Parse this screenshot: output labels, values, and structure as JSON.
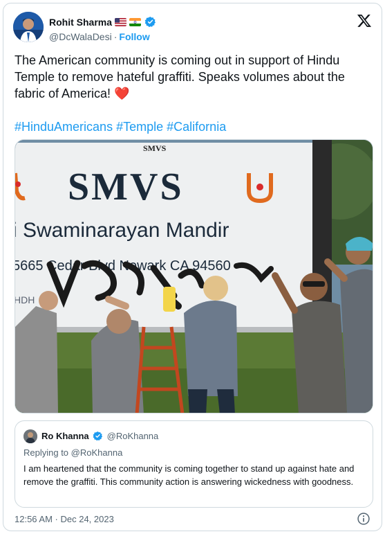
{
  "tweet": {
    "author": {
      "display_name": "Rohit Sharma",
      "flags": [
        "us-flag",
        "india-flag"
      ],
      "verified_icon": "verified-badge-icon",
      "handle": "@DcWalaDesi",
      "separator": "·",
      "follow_label": "Follow"
    },
    "platform_icon": "x-logo-icon",
    "text": "The American community is coming out in support of Hindu Temple to remove hateful graffiti. Speaks volumes about the fabric of America!",
    "emoji": "❤️",
    "hashtags": [
      "#HinduAmericans",
      "#Temple",
      "#California"
    ],
    "media": {
      "sign_top": "SMVS",
      "sign_main": "SMVS",
      "sign_subtitle": "i Swaminarayan Mandir",
      "sign_address": "5665 Cedar Blvd Newark CA 94560",
      "sign_small": "HDH"
    },
    "quote": {
      "display_name": "Ro Khanna",
      "handle": "@RoKhanna",
      "reply_prefix": "Replying to",
      "reply_to": "@RoKhanna",
      "text": "I am heartened that the community is coming together to stand up against hate and remove the graffiti. This community action is answering wickedness with goodness."
    },
    "timestamp": "12:56 AM · Dec 24, 2023",
    "info_icon": "info-icon"
  },
  "colors": {
    "accent": "#1d9bf0",
    "text": "#0f1419",
    "secondary": "#536471",
    "border": "#cfd9de",
    "heart": "#e0245e"
  }
}
